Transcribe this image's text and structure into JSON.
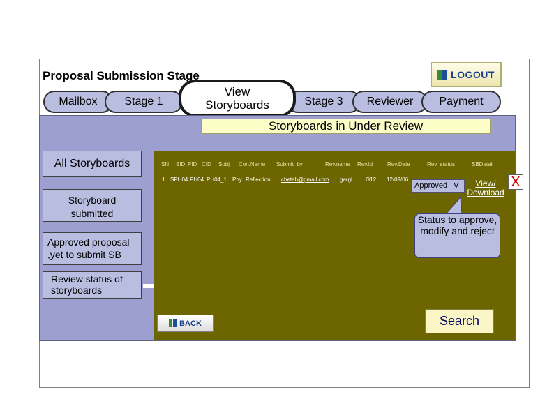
{
  "header": {
    "title": "Proposal Submission Stage",
    "logout_label": "LOGOUT"
  },
  "tabs": [
    {
      "label": "Mailbox"
    },
    {
      "label": "Stage 1"
    },
    {
      "label": "View Storyboards",
      "active": true
    },
    {
      "label": "Stage 3"
    },
    {
      "label": "Reviewer"
    },
    {
      "label": "Payment"
    }
  ],
  "tab_active_line1": "View",
  "tab_active_line2": "Storyboards",
  "review_title": "Storyboards in Under Review",
  "sidebar": {
    "items": [
      {
        "label": "All Storyboards"
      },
      {
        "label": "Storyboard submitted"
      },
      {
        "label": "Approved proposal ,yet to submit SB"
      },
      {
        "label": "Review status of storyboards"
      }
    ]
  },
  "table": {
    "headers": [
      "SN",
      "SID",
      "PID",
      "CID",
      "Subj",
      "Con.Name",
      "Submit_by",
      "Rev.name",
      "Rev.id",
      "Rev.Date",
      "Rev_status",
      "SBDetail"
    ],
    "row": {
      "sn": "1",
      "sid": "SPH04",
      "pid": "PH04",
      "cid": "PH04_1",
      "subj": "Phy",
      "con_name": "Reflection",
      "submit_by": "chetah@gmail.com",
      "rev_name": "gargi",
      "rev_id": "G12",
      "rev_date": "12/09/06",
      "rev_status": "Approved",
      "rev_status_arrow": "V",
      "sb_detail": "View/ Download"
    }
  },
  "close_label": "X",
  "callout_text": "Status to approve, modify and reject",
  "back_label": "BACK",
  "search_label": "Search",
  "colors": {
    "panel": "#9c9fd0",
    "table_bg": "#6d6500",
    "tab_bg": "#b9bde0",
    "title_bar": "#fdfdc8"
  }
}
